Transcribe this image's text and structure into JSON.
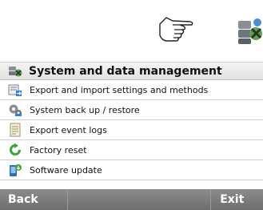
{
  "header_icons": {
    "pointer": "pointing-hand-icon",
    "section": "system-management-icon"
  },
  "menu": {
    "title": "System and data management",
    "items": [
      {
        "label": "Export and import settings and methods",
        "icon": "export-import-icon"
      },
      {
        "label": "System back up / restore",
        "icon": "backup-restore-icon"
      },
      {
        "label": "Export event logs",
        "icon": "event-log-icon"
      },
      {
        "label": "Factory reset",
        "icon": "factory-reset-icon"
      },
      {
        "label": "Software update",
        "icon": "software-update-icon"
      }
    ]
  },
  "footer": {
    "back_label": "Back",
    "exit_label": "Exit"
  }
}
